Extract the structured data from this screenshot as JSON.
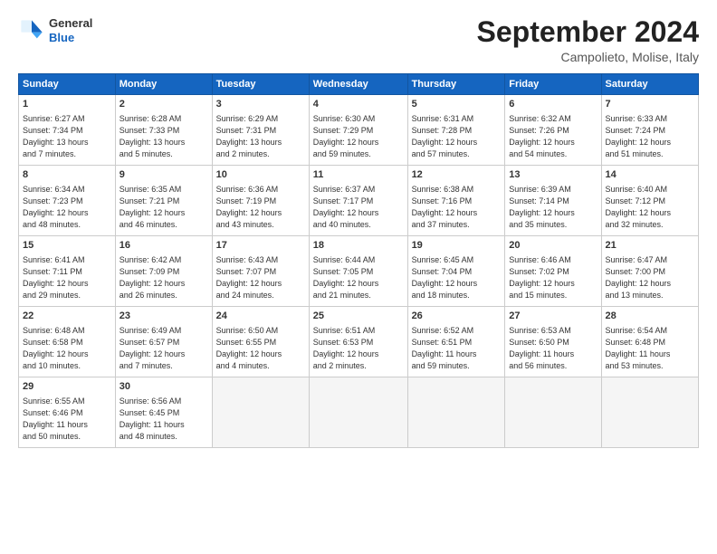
{
  "header": {
    "logo_general": "General",
    "logo_blue": "Blue",
    "month_title": "September 2024",
    "location": "Campolieto, Molise, Italy"
  },
  "days_of_week": [
    "Sunday",
    "Monday",
    "Tuesday",
    "Wednesday",
    "Thursday",
    "Friday",
    "Saturday"
  ],
  "weeks": [
    [
      {
        "day": "1",
        "info": "Sunrise: 6:27 AM\nSunset: 7:34 PM\nDaylight: 13 hours\nand 7 minutes."
      },
      {
        "day": "2",
        "info": "Sunrise: 6:28 AM\nSunset: 7:33 PM\nDaylight: 13 hours\nand 5 minutes."
      },
      {
        "day": "3",
        "info": "Sunrise: 6:29 AM\nSunset: 7:31 PM\nDaylight: 13 hours\nand 2 minutes."
      },
      {
        "day": "4",
        "info": "Sunrise: 6:30 AM\nSunset: 7:29 PM\nDaylight: 12 hours\nand 59 minutes."
      },
      {
        "day": "5",
        "info": "Sunrise: 6:31 AM\nSunset: 7:28 PM\nDaylight: 12 hours\nand 57 minutes."
      },
      {
        "day": "6",
        "info": "Sunrise: 6:32 AM\nSunset: 7:26 PM\nDaylight: 12 hours\nand 54 minutes."
      },
      {
        "day": "7",
        "info": "Sunrise: 6:33 AM\nSunset: 7:24 PM\nDaylight: 12 hours\nand 51 minutes."
      }
    ],
    [
      {
        "day": "8",
        "info": "Sunrise: 6:34 AM\nSunset: 7:23 PM\nDaylight: 12 hours\nand 48 minutes."
      },
      {
        "day": "9",
        "info": "Sunrise: 6:35 AM\nSunset: 7:21 PM\nDaylight: 12 hours\nand 46 minutes."
      },
      {
        "day": "10",
        "info": "Sunrise: 6:36 AM\nSunset: 7:19 PM\nDaylight: 12 hours\nand 43 minutes."
      },
      {
        "day": "11",
        "info": "Sunrise: 6:37 AM\nSunset: 7:17 PM\nDaylight: 12 hours\nand 40 minutes."
      },
      {
        "day": "12",
        "info": "Sunrise: 6:38 AM\nSunset: 7:16 PM\nDaylight: 12 hours\nand 37 minutes."
      },
      {
        "day": "13",
        "info": "Sunrise: 6:39 AM\nSunset: 7:14 PM\nDaylight: 12 hours\nand 35 minutes."
      },
      {
        "day": "14",
        "info": "Sunrise: 6:40 AM\nSunset: 7:12 PM\nDaylight: 12 hours\nand 32 minutes."
      }
    ],
    [
      {
        "day": "15",
        "info": "Sunrise: 6:41 AM\nSunset: 7:11 PM\nDaylight: 12 hours\nand 29 minutes."
      },
      {
        "day": "16",
        "info": "Sunrise: 6:42 AM\nSunset: 7:09 PM\nDaylight: 12 hours\nand 26 minutes."
      },
      {
        "day": "17",
        "info": "Sunrise: 6:43 AM\nSunset: 7:07 PM\nDaylight: 12 hours\nand 24 minutes."
      },
      {
        "day": "18",
        "info": "Sunrise: 6:44 AM\nSunset: 7:05 PM\nDaylight: 12 hours\nand 21 minutes."
      },
      {
        "day": "19",
        "info": "Sunrise: 6:45 AM\nSunset: 7:04 PM\nDaylight: 12 hours\nand 18 minutes."
      },
      {
        "day": "20",
        "info": "Sunrise: 6:46 AM\nSunset: 7:02 PM\nDaylight: 12 hours\nand 15 minutes."
      },
      {
        "day": "21",
        "info": "Sunrise: 6:47 AM\nSunset: 7:00 PM\nDaylight: 12 hours\nand 13 minutes."
      }
    ],
    [
      {
        "day": "22",
        "info": "Sunrise: 6:48 AM\nSunset: 6:58 PM\nDaylight: 12 hours\nand 10 minutes."
      },
      {
        "day": "23",
        "info": "Sunrise: 6:49 AM\nSunset: 6:57 PM\nDaylight: 12 hours\nand 7 minutes."
      },
      {
        "day": "24",
        "info": "Sunrise: 6:50 AM\nSunset: 6:55 PM\nDaylight: 12 hours\nand 4 minutes."
      },
      {
        "day": "25",
        "info": "Sunrise: 6:51 AM\nSunset: 6:53 PM\nDaylight: 12 hours\nand 2 minutes."
      },
      {
        "day": "26",
        "info": "Sunrise: 6:52 AM\nSunset: 6:51 PM\nDaylight: 11 hours\nand 59 minutes."
      },
      {
        "day": "27",
        "info": "Sunrise: 6:53 AM\nSunset: 6:50 PM\nDaylight: 11 hours\nand 56 minutes."
      },
      {
        "day": "28",
        "info": "Sunrise: 6:54 AM\nSunset: 6:48 PM\nDaylight: 11 hours\nand 53 minutes."
      }
    ],
    [
      {
        "day": "29",
        "info": "Sunrise: 6:55 AM\nSunset: 6:46 PM\nDaylight: 11 hours\nand 50 minutes."
      },
      {
        "day": "30",
        "info": "Sunrise: 6:56 AM\nSunset: 6:45 PM\nDaylight: 11 hours\nand 48 minutes."
      },
      {
        "day": "",
        "info": ""
      },
      {
        "day": "",
        "info": ""
      },
      {
        "day": "",
        "info": ""
      },
      {
        "day": "",
        "info": ""
      },
      {
        "day": "",
        "info": ""
      }
    ]
  ]
}
